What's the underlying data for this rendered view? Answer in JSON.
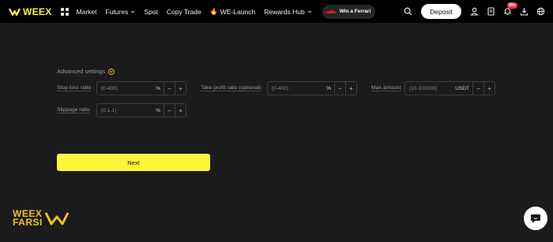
{
  "header": {
    "logo": "WEEX",
    "nav": [
      {
        "label": "Market",
        "dropdown": false
      },
      {
        "label": "Futures",
        "dropdown": true
      },
      {
        "label": "Spot",
        "dropdown": false
      },
      {
        "label": "Copy Trade",
        "dropdown": false
      },
      {
        "label": "WE-Launch",
        "dropdown": false,
        "icon": "fire-icon"
      },
      {
        "label": "Rewards Hub",
        "dropdown": true
      }
    ],
    "promo": "Win a Ferrari",
    "deposit": "Deposit",
    "notifications_badge": "99+"
  },
  "settings": {
    "title": "Advanced settings",
    "fields": {
      "stop_loss": {
        "label": "Stop loss ratio",
        "placeholder": "(0-400)",
        "unit": "%"
      },
      "take_profit": {
        "label": "Take profit ratio (optional)",
        "placeholder": "(0-400)",
        "unit": "%"
      },
      "max_amount": {
        "label": "Max amount",
        "placeholder": "(10-100000)",
        "unit": "USDT"
      },
      "slippage": {
        "label": "Slippage ratio",
        "placeholder": "(0.1-1)",
        "unit": "%"
      }
    },
    "minus": "−",
    "plus": "+"
  },
  "next_button": "Next",
  "footer_brand": {
    "line1": "WEEX",
    "line2": "FARSI"
  },
  "colors": {
    "accent": "#fff43b",
    "background": "#1b1b1b",
    "topbar": "#000000"
  }
}
